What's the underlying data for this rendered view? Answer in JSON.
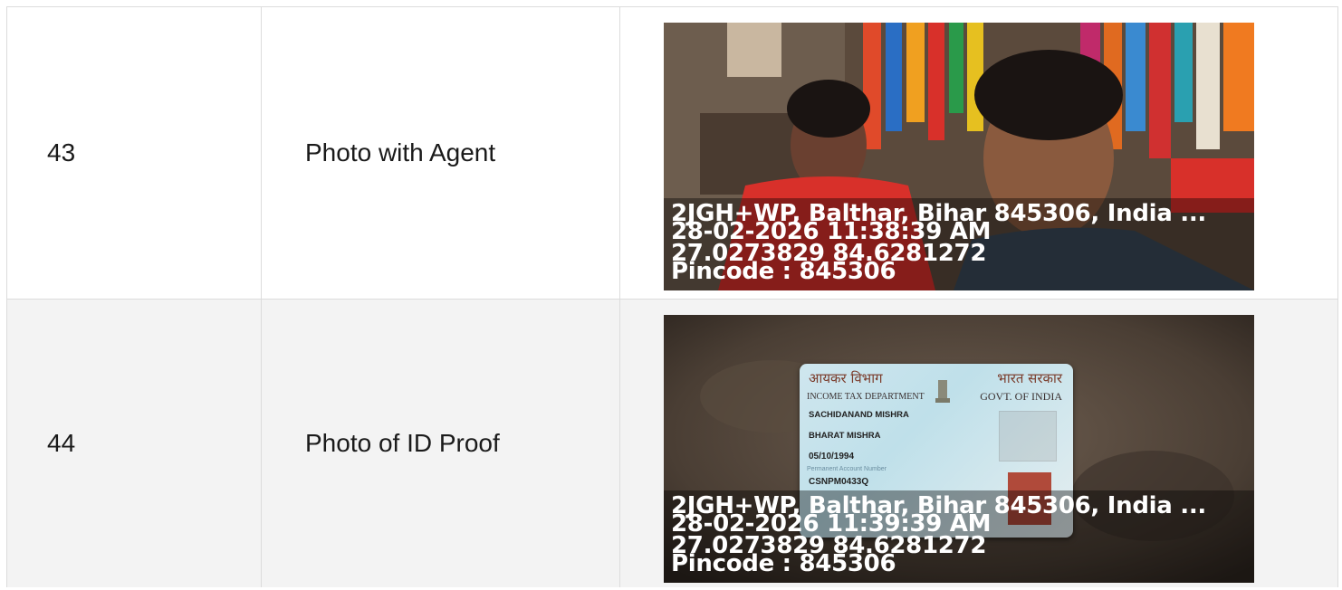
{
  "rows": [
    {
      "number": "43",
      "label": "Photo with Agent",
      "photo": {
        "subject": "selfie-with-agent",
        "stamp": {
          "address": "2JGH+WP, Balthar, Bihar 845306, India ...",
          "datetime": "28-02-2026 11:38:39 AM",
          "coordinates": "27.0273829 84.6281272",
          "pincode": "Pincode : 845306"
        }
      }
    },
    {
      "number": "44",
      "label": "Photo of ID Proof",
      "photo": {
        "subject": "pan-card",
        "card": {
          "hindi_left": "आयकर विभाग",
          "hindi_right": "भारत सरकार",
          "dept": "INCOME TAX DEPARTMENT",
          "govt": "GOVT. OF INDIA",
          "name": "SACHIDANAND MISHRA",
          "father": "BHARAT MISHRA",
          "dob": "05/10/1994",
          "pan_label": "Permanent Account Number",
          "pan": "CSNPM0433Q"
        },
        "stamp": {
          "address": "2JGH+WP, Balthar, Bihar 845306, India ...",
          "datetime": "28-02-2026 11:39:39 AM",
          "coordinates": "27.0273829 84.6281272",
          "pincode": "Pincode : 845306"
        }
      }
    }
  ]
}
